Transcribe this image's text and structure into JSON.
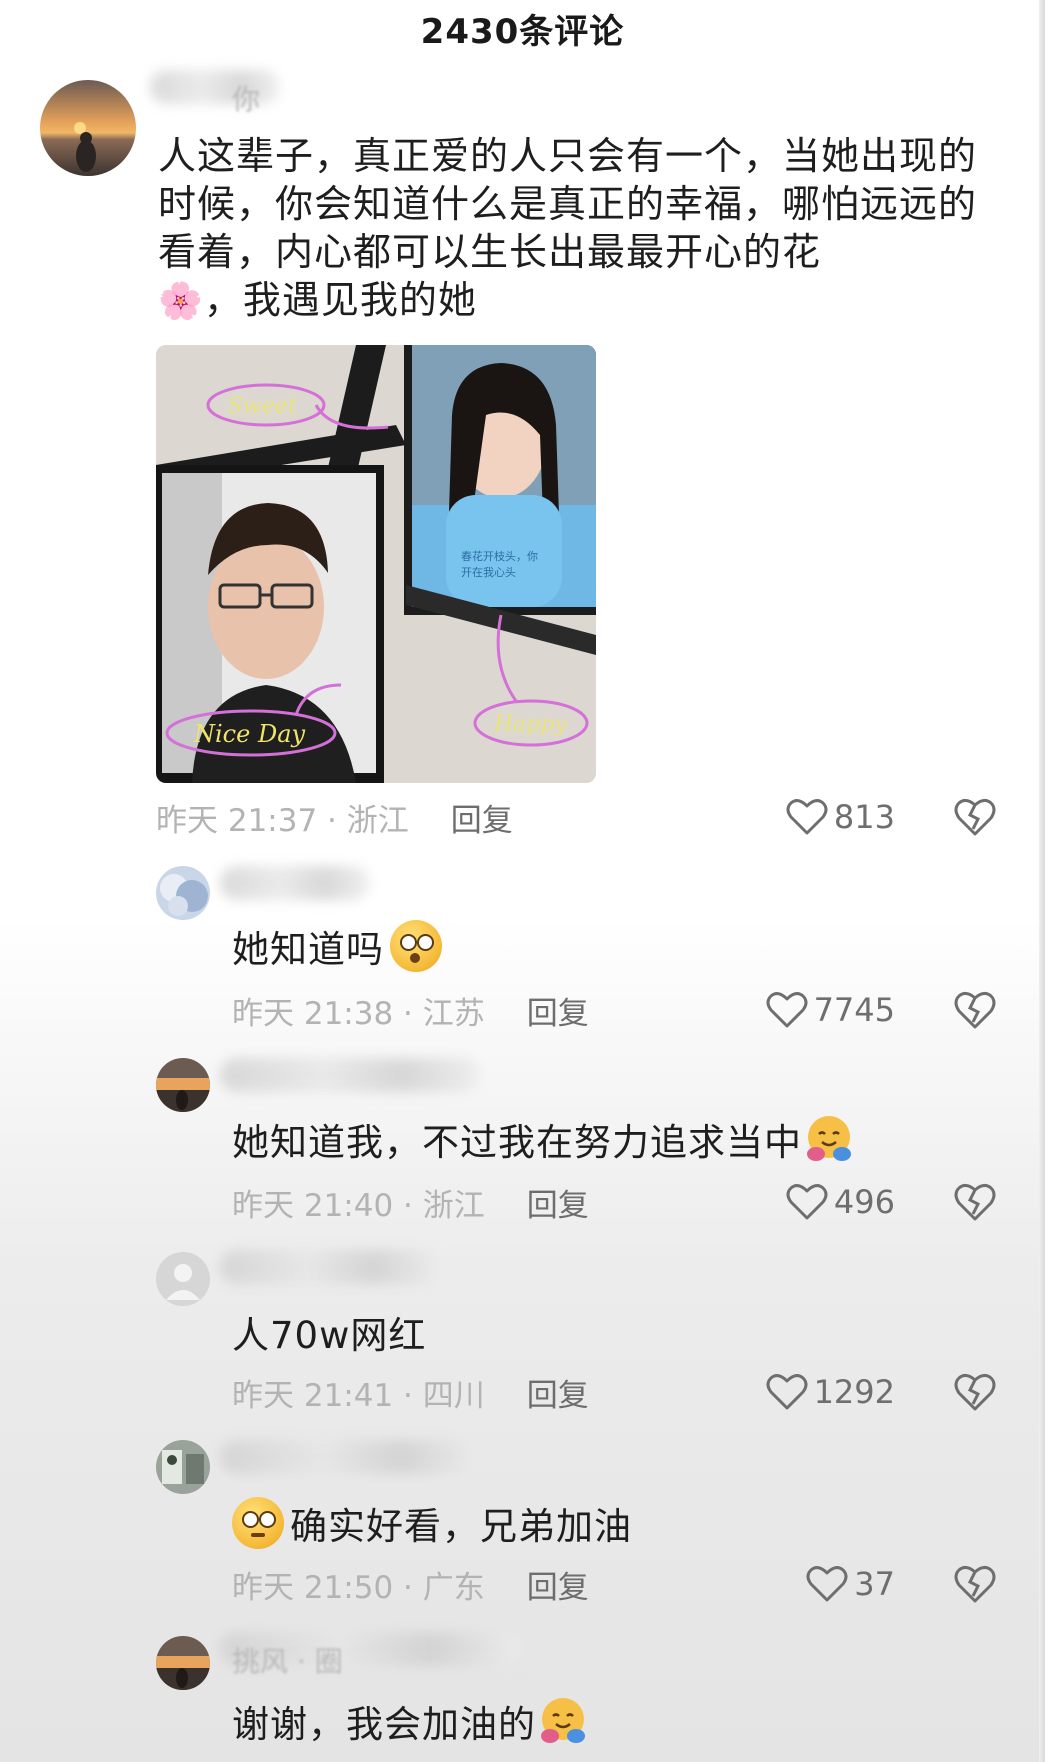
{
  "header": {
    "title": "2430条评论"
  },
  "main_comment": {
    "username": "你",
    "text": "人这辈子，真正爱的人只会有一个，当她出现的时候，你会知道什么是真正的幸福，哪怕远远的看着，内心都可以生长出最最开心的花",
    "text_after_emoji": "，我遇见我的她",
    "emoji": "🌸",
    "image_labels": {
      "sweet": "Sweet",
      "nice_day": "Nice Day",
      "happy": "Happy"
    },
    "time_location": "昨天 21:37 · 浙江",
    "reply_label": "回复",
    "likes": "813"
  },
  "replies": [
    {
      "text": "她知道吗",
      "time_location": "昨天 21:38 · 江苏",
      "reply_label": "回复",
      "likes": "7745"
    },
    {
      "text": "她知道我，不过我在努力追求当中",
      "time_location": "昨天 21:40 · 浙江",
      "reply_label": "回复",
      "likes": "496"
    },
    {
      "text": "人70w网红",
      "time_location": "昨天 21:41 · 四川",
      "reply_label": "回复",
      "likes": "1292"
    },
    {
      "text": "确实好看，兄弟加油",
      "time_location": "昨天 21:50 · 广东",
      "reply_label": "回复",
      "likes": "37"
    },
    {
      "username": "挑风  ·  圈",
      "text": "谢谢，我会加油的"
    }
  ],
  "colors": {
    "meta_gray": "#b3b3b3",
    "text_dark": "#1e1e1e",
    "icon_gray": "#6e6e6e"
  },
  "icons": [
    "heart-icon",
    "broken-heart-icon",
    "flower-emoji",
    "flushed-face-emoji",
    "hugging-face-emoji",
    "rolling-eyes-emoji"
  ]
}
